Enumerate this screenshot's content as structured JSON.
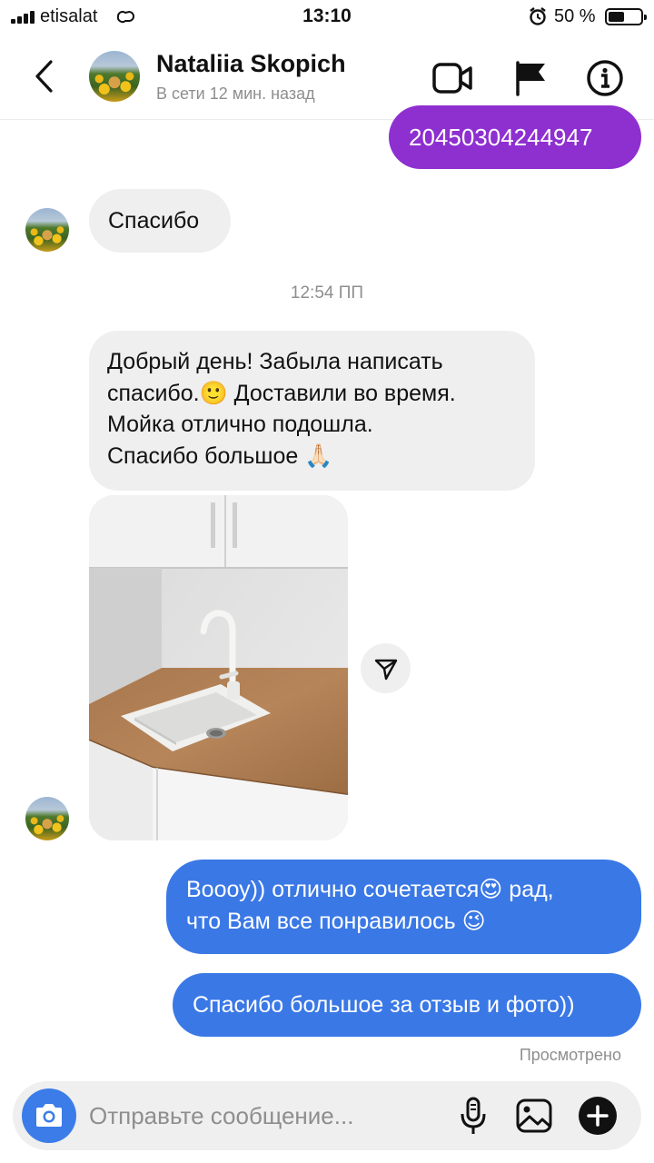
{
  "status_bar": {
    "carrier": "etisalat",
    "time": "13:10",
    "battery": "50 %"
  },
  "header": {
    "back_icon": "chevron-left-icon",
    "contact_name": "Nataliia Skopich",
    "contact_status": "В сети 12 мин. назад",
    "icons": [
      "video-camera-icon",
      "flag-icon",
      "info-icon"
    ]
  },
  "messages": {
    "outgoing_number": "20450304244947",
    "incoming_thanks": "Спасибо",
    "timestamp": "12:54 ПП",
    "incoming_long": {
      "line1": "Добрый день! Забыла написать",
      "line2": "спасибо.🙂 Доставили во время.",
      "line3": "Мойка отлично подошла.",
      "line4": "Спасибо большое 🙏🏻"
    },
    "outgoing_reply": {
      "line1": "Воооу)) отлично сочетается😍 рад,",
      "line2": "что Вам все понравилось 😉"
    },
    "outgoing_thanks": "Спасибо большое за отзыв и фото))",
    "seen_label": "Просмотрено"
  },
  "composer": {
    "placeholder": "Отправьте сообщение...",
    "icons": [
      "camera-icon",
      "microphone-icon",
      "gallery-icon",
      "plus-icon"
    ]
  },
  "colors": {
    "purple_bubble": "#8e2fd0",
    "blue_bubble": "#3a78e6",
    "incoming_bubble": "#efefef",
    "camera_button": "#3b7ce8"
  }
}
